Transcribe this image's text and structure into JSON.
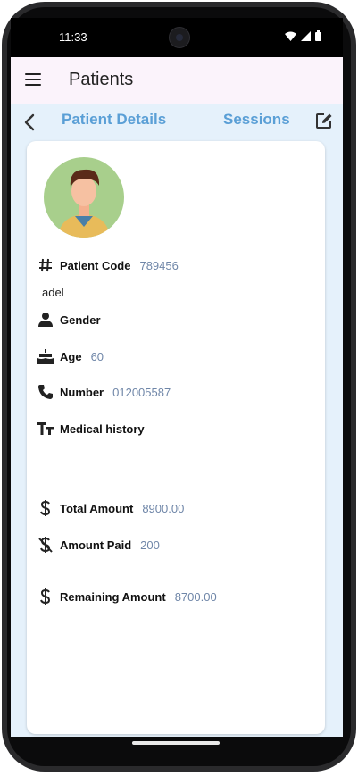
{
  "status_bar": {
    "time": "11:33"
  },
  "app_bar": {
    "title": "Patients",
    "menu_icon": "menu-icon"
  },
  "tabs": {
    "details": "Patient Details",
    "sessions": "Sessions"
  },
  "patient": {
    "code_label": "Patient Code",
    "code": "789456",
    "name": "adel",
    "gender_label": "Gender",
    "gender": "",
    "age_label": "Age",
    "age": "60",
    "number_label": "Number",
    "number": "012005587",
    "history_label": "Medical history",
    "history": "",
    "total_label": "Total Amount",
    "total": "8900.00",
    "paid_label": "Amount Paid",
    "paid": "200",
    "remaining_label": "Remaining Amount",
    "remaining": "8700.00"
  },
  "colors": {
    "accent": "#5a9fd6",
    "app_bar_bg": "#fbf3fb",
    "content_bg": "#e5f1fb",
    "value_text": "#6f86a8"
  }
}
